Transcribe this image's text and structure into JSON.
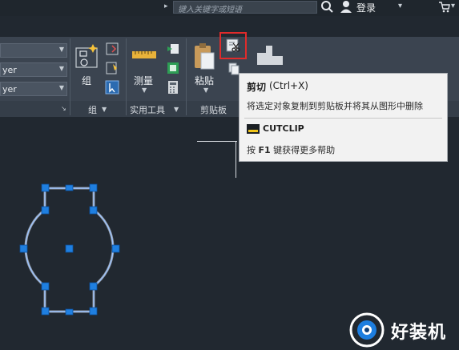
{
  "topbar": {
    "search_placeholder": "键入关键字或短语",
    "login_label": "登录"
  },
  "ribbon": {
    "layer_combos": [
      {
        "value": ""
      },
      {
        "value": "yer"
      },
      {
        "value": "yer"
      }
    ],
    "group_panel": {
      "group_button_label": "组",
      "panel_title": "组"
    },
    "utilities_panel": {
      "measure_label": "测量",
      "panel_title": "实用工具"
    },
    "clipboard_panel": {
      "paste_label": "粘贴",
      "panel_title": "剪贴板"
    }
  },
  "tooltip": {
    "title": "剪切",
    "shortcut": "(Ctrl+X)",
    "description": "将选定对象复制到剪贴板并将其从图形中删除",
    "command": "CUTCLIP",
    "help_prefix": "按",
    "help_key": "F1",
    "help_suffix": "键获得更多帮助"
  },
  "watermark": {
    "text": "好装机"
  },
  "colors": {
    "ribbon_bg": "#3b4450",
    "canvas_bg": "#212830",
    "grip_blue": "#1f7fe0",
    "highlight_red": "#e02b2b",
    "tooltip_bg": "#f2f2f2"
  }
}
